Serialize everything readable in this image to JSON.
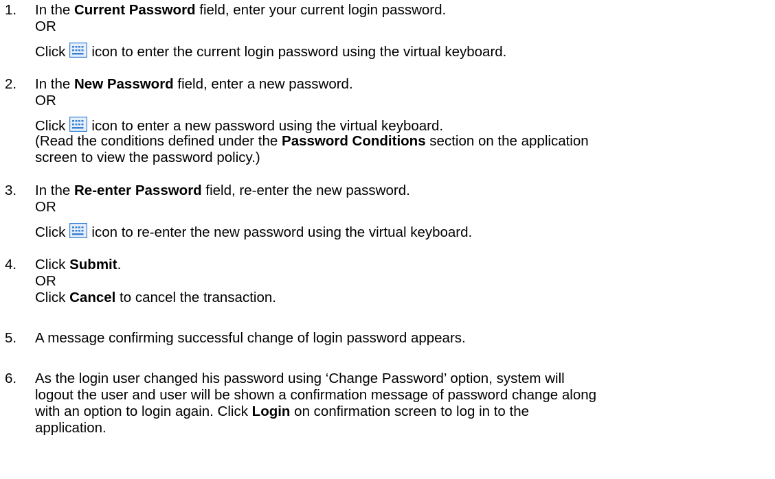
{
  "steps": [
    {
      "number": "1.",
      "lines": [
        {
          "a": "In the ",
          "b": "Current Password",
          "c": " field, enter your current login password."
        },
        {
          "text": "OR"
        },
        {
          "a": "Click",
          "icon": "virtual-keyboard-icon",
          "c": "icon to enter the current login password using the virtual keyboard."
        }
      ]
    },
    {
      "number": "2.",
      "lines": [
        {
          "a": "In the ",
          "b": "New Password",
          "c": " field, enter a new password."
        },
        {
          "text": "OR"
        },
        {
          "a": "Click",
          "icon": "virtual-keyboard-icon",
          "c": "icon to enter a new password using the virtual keyboard."
        },
        {
          "a": "(Read the conditions defined under the ",
          "b": "Password Conditions",
          "c": " section on the application"
        },
        {
          "text": "screen to view the password policy.)"
        }
      ]
    },
    {
      "number": "3.",
      "lines": [
        {
          "a": "In the ",
          "b": "Re-enter Password",
          "c": " field, re-enter the new password."
        },
        {
          "text": "OR"
        },
        {
          "a": "Click",
          "icon": "virtual-keyboard-icon",
          "c": "icon to re-enter the new password using the virtual keyboard."
        }
      ]
    },
    {
      "number": "4.",
      "lines": [
        {
          "a": "Click ",
          "b": "Submit",
          "c": "."
        },
        {
          "text": "OR"
        },
        {
          "a": "Click ",
          "b": "Cancel",
          "c": " to cancel the transaction."
        }
      ]
    },
    {
      "number": "5.",
      "lines": [
        {
          "text": "A message confirming successful change of login password appears."
        }
      ]
    },
    {
      "number": "6.",
      "lines": [
        {
          "text": "As the login user changed his password using ‘Change Password’ option, system will"
        },
        {
          "text": "logout the user and user will be shown a confirmation message of password change along"
        },
        {
          "a": "with an option to login again. Click ",
          "b": "Login",
          "c": " on confirmation screen to log in to the"
        },
        {
          "text": "application."
        }
      ]
    }
  ],
  "colors": {
    "text": "#000000",
    "icon_border": "#3a7fd5",
    "icon_fill": "#e6f0fb"
  }
}
